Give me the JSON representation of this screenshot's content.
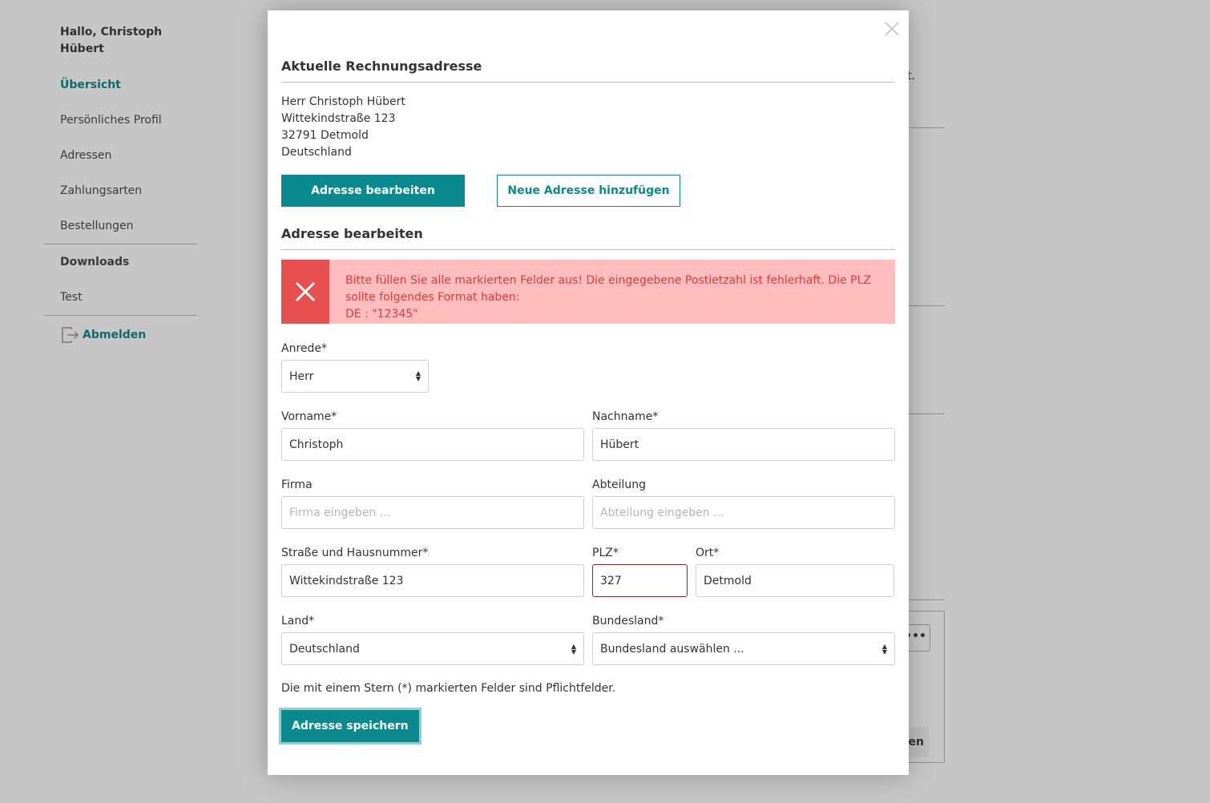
{
  "sidebar": {
    "greeting": "Hallo, Christoph Hübert",
    "items": [
      "Übersicht",
      "Persönliches Profil",
      "Adressen",
      "Zahlungsarten",
      "Bestellungen"
    ],
    "downloads": "Downloads",
    "test": "Test",
    "logout": "Abmelden"
  },
  "background": {
    "text_fragment": "t.",
    "button_fragment": "en"
  },
  "modal": {
    "current_title": "Aktuelle Rechnungsadresse",
    "address": [
      "Herr Christoph Hübert",
      "Wittekindstraße 123",
      "32791 Detmold",
      "Deutschland"
    ],
    "edit_button": "Adresse bearbeiten",
    "new_button": "Neue Adresse hinzufügen",
    "edit_title": "Adresse bearbeiten",
    "error": {
      "line1": "Bitte füllen Sie alle markierten Felder aus! Die eingegebene Postietzahl ist fehlerhaft. Die PLZ",
      "line2": "sollte folgendes Format haben:",
      "line3": "DE : \"12345\""
    },
    "fields": {
      "salutation": {
        "label": "Anrede*",
        "value": "Herr"
      },
      "firstname": {
        "label": "Vorname*",
        "value": "Christoph"
      },
      "lastname": {
        "label": "Nachname*",
        "value": "Hübert"
      },
      "company": {
        "label": "Firma",
        "placeholder": "Firma eingeben ..."
      },
      "department": {
        "label": "Abteilung",
        "placeholder": "Abteilung eingeben ..."
      },
      "street": {
        "label": "Straße und Hausnummer*",
        "value": "Wittekindstraße 123"
      },
      "zip": {
        "label": "PLZ*",
        "value": "327"
      },
      "city": {
        "label": "Ort*",
        "value": "Detmold"
      },
      "country": {
        "label": "Land*",
        "value": "Deutschland"
      },
      "state": {
        "label": "Bundesland*",
        "value": "Bundesland auswählen ..."
      }
    },
    "required_note": "Die mit einem Stern (*) markierten Felder sind Pflichtfelder.",
    "save_button": "Adresse speichern"
  },
  "colors": {
    "accent": "#0a8a8e",
    "error_bg": "#ffbdbd",
    "error_icon_bg": "#e84f4f",
    "error_text": "#e03a3a"
  }
}
